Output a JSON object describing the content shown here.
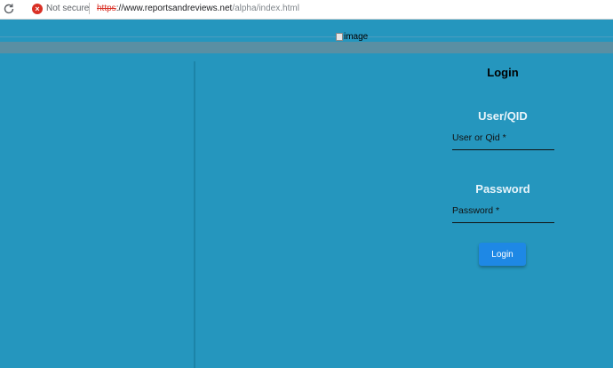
{
  "browser": {
    "security_text": "Not secure",
    "url_scheme": "https",
    "url_host": "://www.reportsandreviews.net",
    "url_path": "/alpha/index.html"
  },
  "header": {
    "image_alt": "image"
  },
  "login": {
    "title": "Login",
    "user_section": "User/QID",
    "user_placeholder": "User or Qid *",
    "password_section": "Password",
    "password_placeholder": "Password *",
    "button_label": "Login"
  },
  "icons": {
    "reload": "reload-icon",
    "warning": "warning-circle-icon",
    "broken_image": "broken-image-icon"
  },
  "colors": {
    "page_bg": "#2596be",
    "button_bg": "#1e88e5",
    "insecure_red": "#d93025"
  }
}
